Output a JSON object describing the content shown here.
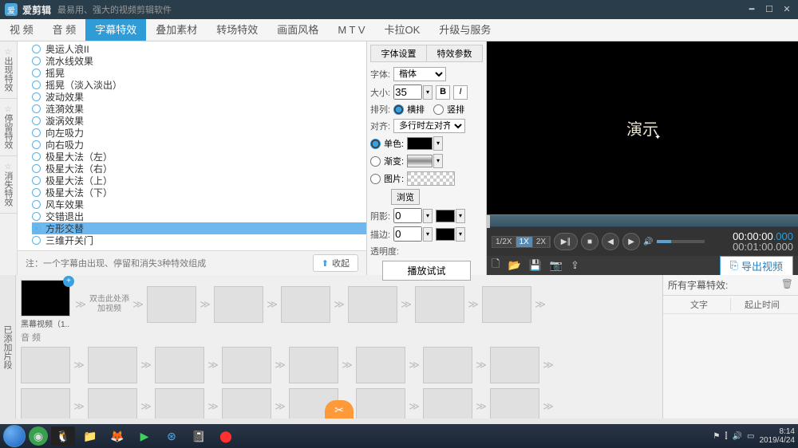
{
  "title": {
    "app_name": "爱剪辑",
    "tagline": "最易用、强大的视频剪辑软件"
  },
  "main_tabs": [
    "视 频",
    "音 频",
    "字幕特效",
    "叠加素材",
    "转场特效",
    "画面风格",
    "M T V",
    "卡拉OK",
    "升级与服务"
  ],
  "main_tab_active": 2,
  "side_tabs": [
    "出现特效",
    "停留特效",
    "消失特效"
  ],
  "effects": [
    "奥运人浪II",
    "流水线效果",
    "摇晃",
    "摇晃（淡入淡出）",
    "波动效果",
    "涟漪效果",
    "漩涡效果",
    "向左吸力",
    "向右吸力",
    "极星大法（左）",
    "极星大法（右）",
    "极星大法（上）",
    "极星大法（下）",
    "风车效果",
    "交错退出",
    "方形交替",
    "三维开关门"
  ],
  "effect_selected": 15,
  "note": "注：一个字幕由出现、停留和消失3种特效组成",
  "collapse_label": "收起",
  "attr_tabs": [
    "字体设置",
    "特效参数"
  ],
  "attrs": {
    "font_label": "字体:",
    "font_value": "楷体",
    "size_label": "大小:",
    "size_value": "35",
    "arrange_label": "排列:",
    "arrange_h": "横排",
    "arrange_v": "竖排",
    "align_label": "对齐:",
    "align_value": "多行时左对齐",
    "color_solid": "单色:",
    "color_grad": "渐变:",
    "color_img": "图片:",
    "browse": "浏览",
    "shadow_label": "阴影:",
    "shadow_value": "0",
    "stroke_label": "描边:",
    "stroke_value": "0",
    "opacity_label": "透明度:",
    "play_try": "播放试试"
  },
  "preview": {
    "demo_text": "演示"
  },
  "speeds": [
    "1/2X",
    "1X",
    "2X"
  ],
  "speed_active": 1,
  "time": {
    "current": "00:00:00",
    "current_ms": ".000",
    "total": "00:01:00",
    "total_ms": ".000"
  },
  "export_label": "导出视频",
  "timeline": {
    "side_tab": "已添加片段",
    "clip_label": "黑幕视频（1...",
    "add_hint": "双击此处添加视频",
    "audio_label": "音 频"
  },
  "fx_inspector": {
    "title": "所有字幕特效:",
    "col_text": "文字",
    "col_time": "起止时间"
  },
  "taskbar": {
    "time": "8:14",
    "date": "2019/4/24"
  }
}
